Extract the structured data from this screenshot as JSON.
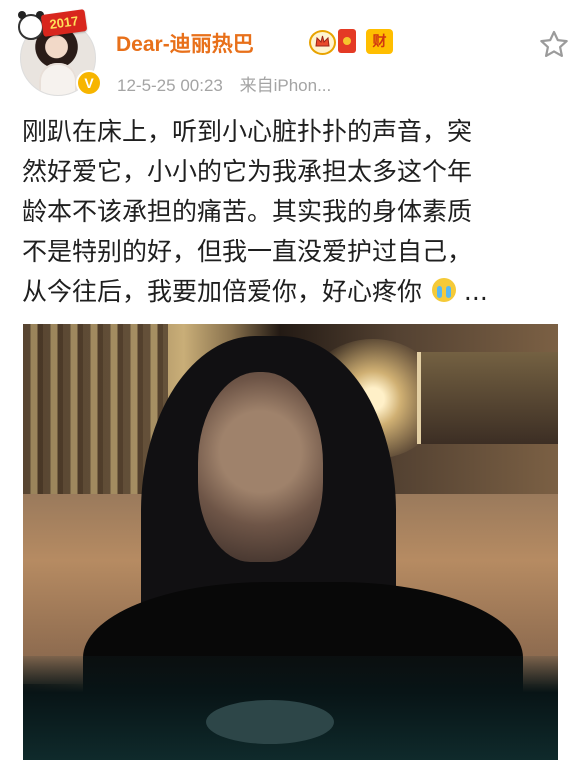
{
  "post": {
    "author_name": "Dear-迪丽热巴",
    "timestamp": "12-5-25 00:23",
    "source": "来自iPhon...",
    "badge_year": "2017",
    "wealth_badge": "财",
    "text_lines": [
      "刚趴在床上，听到小心脏扑扑的声音，突",
      "然好爱它，小小的它为我承担太多这个年",
      "龄本不该承担的痛苦。其实我的身体素质",
      "不是特别的好，但我一直没爱护过自己，",
      "从今往后，我要加倍爱你，好心疼你",
      "..."
    ]
  },
  "icons": {
    "favorite": "star-icon",
    "crying": "crying-face-icon",
    "vip": "crown-icon",
    "red_packet": "red-packet-icon",
    "verified": "verified-badge-icon"
  },
  "colors": {
    "author_name": "#e8701a",
    "meta_text": "#a4a4a4",
    "post_text": "#1f1f1f",
    "accent_gold": "#f7b500"
  }
}
